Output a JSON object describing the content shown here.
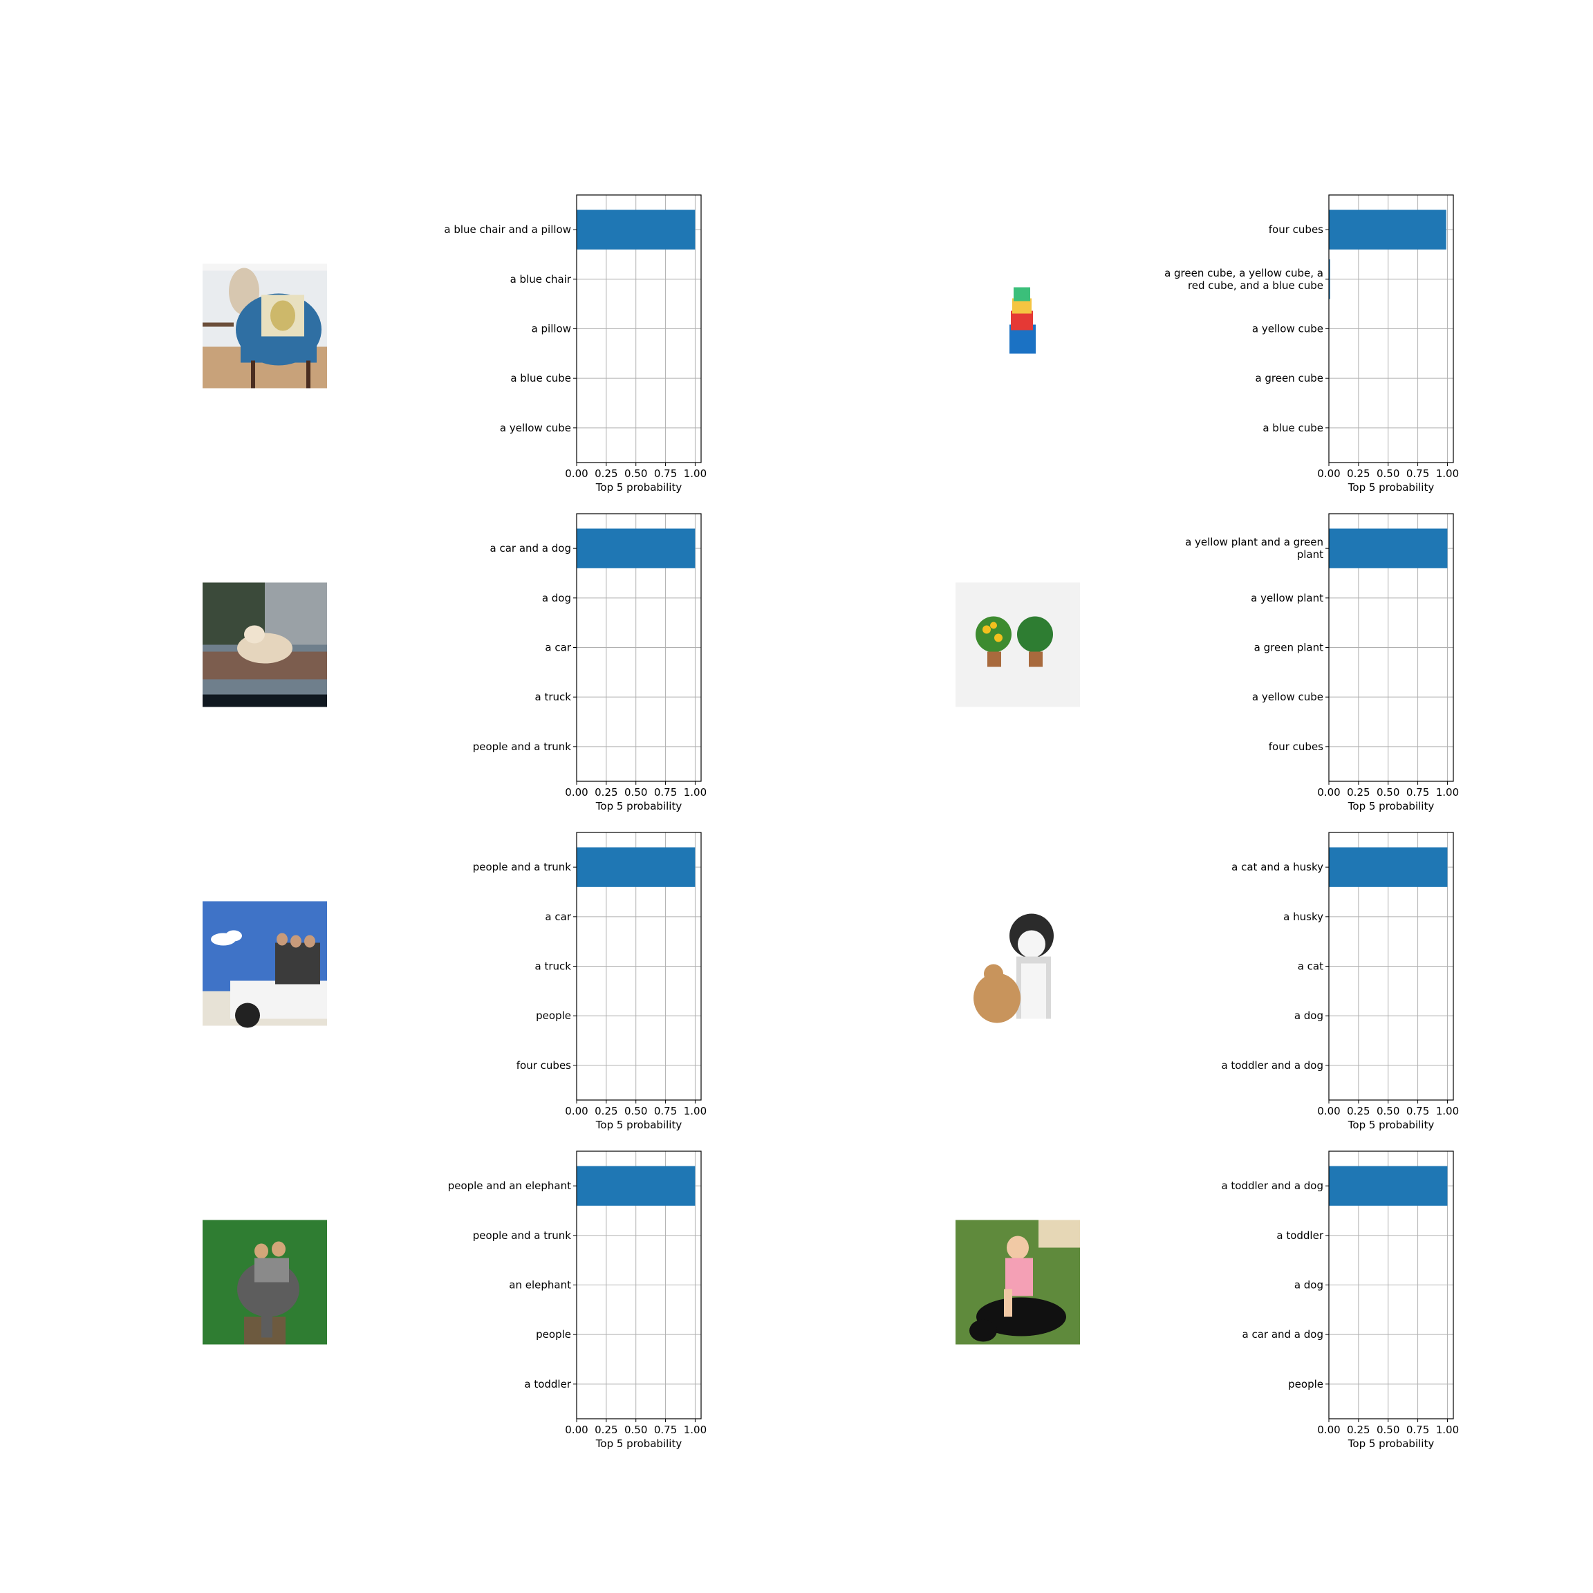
{
  "chart_data": [
    {
      "type": "bar",
      "orientation": "horizontal",
      "image": "blue-armchair-with-pillow-photo",
      "xlabel": "Top 5 probability",
      "xlim": [
        0,
        1.05
      ],
      "xticks": [
        "0.00",
        "0.25",
        "0.50",
        "0.75",
        "1.00"
      ],
      "grid": true,
      "categories": [
        "a blue chair and a pillow",
        "a blue chair",
        "a pillow",
        "a blue cube",
        "a yellow cube"
      ],
      "values": [
        1.0,
        0.0,
        0.0,
        0.0,
        0.0
      ]
    },
    {
      "type": "bar",
      "orientation": "horizontal",
      "image": "stacked-colored-cubes-photo",
      "xlabel": "Top 5 probability",
      "xlim": [
        0,
        1.05
      ],
      "xticks": [
        "0.00",
        "0.25",
        "0.50",
        "0.75",
        "1.00"
      ],
      "grid": true,
      "categories": [
        "four cubes",
        "a green cube, a yellow cube, a red cube, and a blue cube",
        "a yellow cube",
        "a green cube",
        "a blue cube"
      ],
      "values": [
        0.99,
        0.01,
        0.0,
        0.0,
        0.0
      ]
    },
    {
      "type": "bar",
      "orientation": "horizontal",
      "image": "dog-lying-on-car-roof-photo",
      "xlabel": "Top 5 probability",
      "xlim": [
        0,
        1.05
      ],
      "xticks": [
        "0.00",
        "0.25",
        "0.50",
        "0.75",
        "1.00"
      ],
      "grid": true,
      "categories": [
        "a car and a dog",
        "a dog",
        "a car",
        "a truck",
        "people and a trunk"
      ],
      "values": [
        1.0,
        0.0,
        0.0,
        0.0,
        0.0
      ]
    },
    {
      "type": "bar",
      "orientation": "horizontal",
      "image": "two-potted-plants-photo",
      "xlabel": "Top 5 probability",
      "xlim": [
        0,
        1.05
      ],
      "xticks": [
        "0.00",
        "0.25",
        "0.50",
        "0.75",
        "1.00"
      ],
      "grid": true,
      "categories": [
        "a yellow plant and a green plant",
        "a yellow plant",
        "a green plant",
        "a yellow cube",
        "four cubes"
      ],
      "values": [
        1.0,
        0.0,
        0.0,
        0.0,
        0.0
      ]
    },
    {
      "type": "bar",
      "orientation": "horizontal",
      "image": "people-on-vehicle-roof-photo",
      "xlabel": "Top 5 probability",
      "xlim": [
        0,
        1.05
      ],
      "xticks": [
        "0.00",
        "0.25",
        "0.50",
        "0.75",
        "1.00"
      ],
      "grid": true,
      "categories": [
        "people and a trunk",
        "a car",
        "a truck",
        "people",
        "four cubes"
      ],
      "values": [
        1.0,
        0.0,
        0.0,
        0.0,
        0.0
      ]
    },
    {
      "type": "bar",
      "orientation": "horizontal",
      "image": "cat-and-husky-photo",
      "xlabel": "Top 5 probability",
      "xlim": [
        0,
        1.05
      ],
      "xticks": [
        "0.00",
        "0.25",
        "0.50",
        "0.75",
        "1.00"
      ],
      "grid": true,
      "categories": [
        "a cat and a husky",
        "a husky",
        "a cat",
        "a dog",
        "a toddler and a dog"
      ],
      "values": [
        1.0,
        0.0,
        0.0,
        0.0,
        0.0
      ]
    },
    {
      "type": "bar",
      "orientation": "horizontal",
      "image": "people-riding-elephant-photo",
      "xlabel": "Top 5 probability",
      "xlim": [
        0,
        1.05
      ],
      "xticks": [
        "0.00",
        "0.25",
        "0.50",
        "0.75",
        "1.00"
      ],
      "grid": true,
      "categories": [
        "people and an elephant",
        "people and a trunk",
        "an elephant",
        "people",
        "a toddler"
      ],
      "values": [
        1.0,
        0.0,
        0.0,
        0.0,
        0.0
      ]
    },
    {
      "type": "bar",
      "orientation": "horizontal",
      "image": "toddler-on-dog-photo",
      "xlabel": "Top 5 probability",
      "xlim": [
        0,
        1.05
      ],
      "xticks": [
        "0.00",
        "0.25",
        "0.50",
        "0.75",
        "1.00"
      ],
      "grid": true,
      "categories": [
        "a toddler and a dog",
        "a toddler",
        "a dog",
        "a car and a dog",
        "people"
      ],
      "values": [
        1.0,
        0.0,
        0.0,
        0.0,
        0.0
      ]
    }
  ],
  "colors": {
    "bar": "#1f77b4",
    "grid": "#b0b0b0",
    "axis": "#000000",
    "text": "#000000",
    "background": "#ffffff"
  }
}
